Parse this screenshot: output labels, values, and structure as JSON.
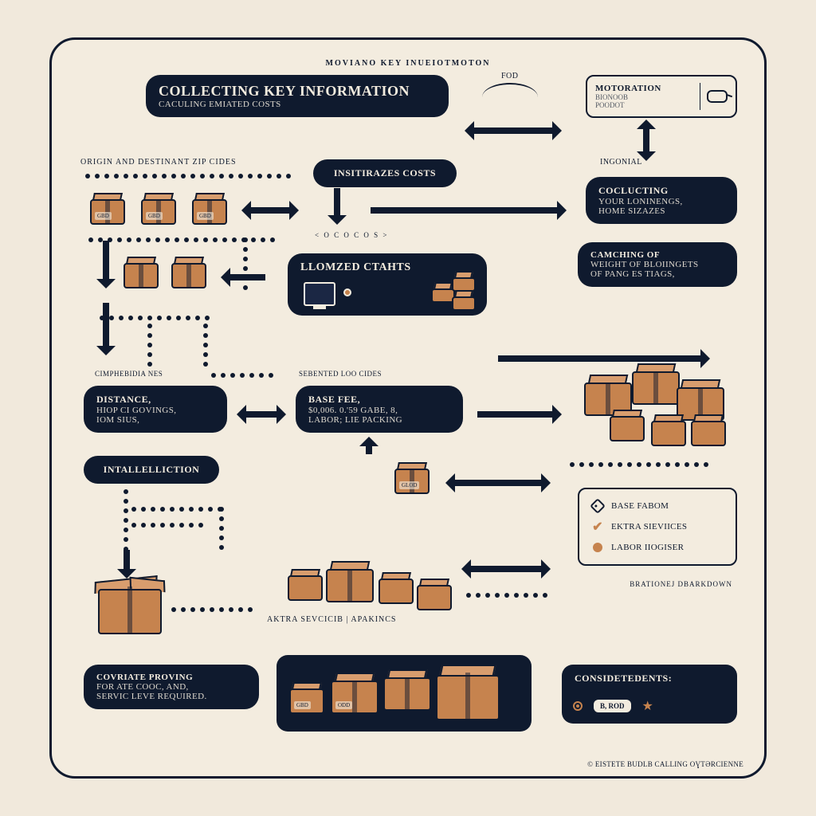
{
  "header_tiny": "MOVIANO KEY INUEIOTMOTON",
  "main_title": {
    "title": "COLLECTING KEY INFORMATION",
    "sub": "CACULING EMIATED COSTS"
  },
  "motoration": {
    "title": "MOTORATION",
    "line1": "BIONOOB",
    "line2": "POODOT"
  },
  "arc_label": "FOD",
  "row1_label": "ORIGIN AND DESTINANT ZIP  CIDES",
  "pill_instirazes": "INSITIRAZES COSTS",
  "ingonial": "INGONIAL",
  "collecting_right": {
    "l1": "COCLUCTING",
    "l2": "YOUR LONINENGS,",
    "l3": "HOME SIZAZES"
  },
  "llomzed": "LLOMZED CTAHTS",
  "canching": {
    "l1": "CAMCHING OF",
    "l2": "WEIGHT OF BLOIINGETS",
    "l3": "OF PANG ES TIAGS,"
  },
  "cimp": "CIMPHEBIDIA NES",
  "sebented": "SEBENTED LOO CIDES",
  "distance": {
    "l1": "DISTANCE,",
    "l2": "HIOP CI GOVINGS,",
    "l3": "IOM SIUS,"
  },
  "base_fee": {
    "l1": "BASE FEE,",
    "l2": "$0,006. 0.'59 GABE, 8,",
    "l3": "LABOR;  LIE PACKING"
  },
  "intallelliction": "INTALLELLICTION",
  "aktra_label": "AKTRA SEVCICIB | APAKINCS",
  "covriate": {
    "l1": "COVRIATE PROVING",
    "l2": "FOR ATE COOC, AND,",
    "l3": "SERVIC LEVE REQUIRED."
  },
  "legend": {
    "base": "BASE FABOM",
    "extra": "EKTRA SIEVIICES",
    "labor": "LABOR  IIOGISER",
    "breakdown": "BRATIONEJ DBARKDOWN"
  },
  "consident": {
    "title": "CONSIDETEDENTS:",
    "chip": "B, ROD"
  },
  "footer": "© EISTETE BUDLB CALLING OƔTƏRCIENNE",
  "box_tag": "GBD",
  "box_tag2": "GLOD",
  "box_tag3": "ODD",
  "code_chars": "< O C O C O S >"
}
